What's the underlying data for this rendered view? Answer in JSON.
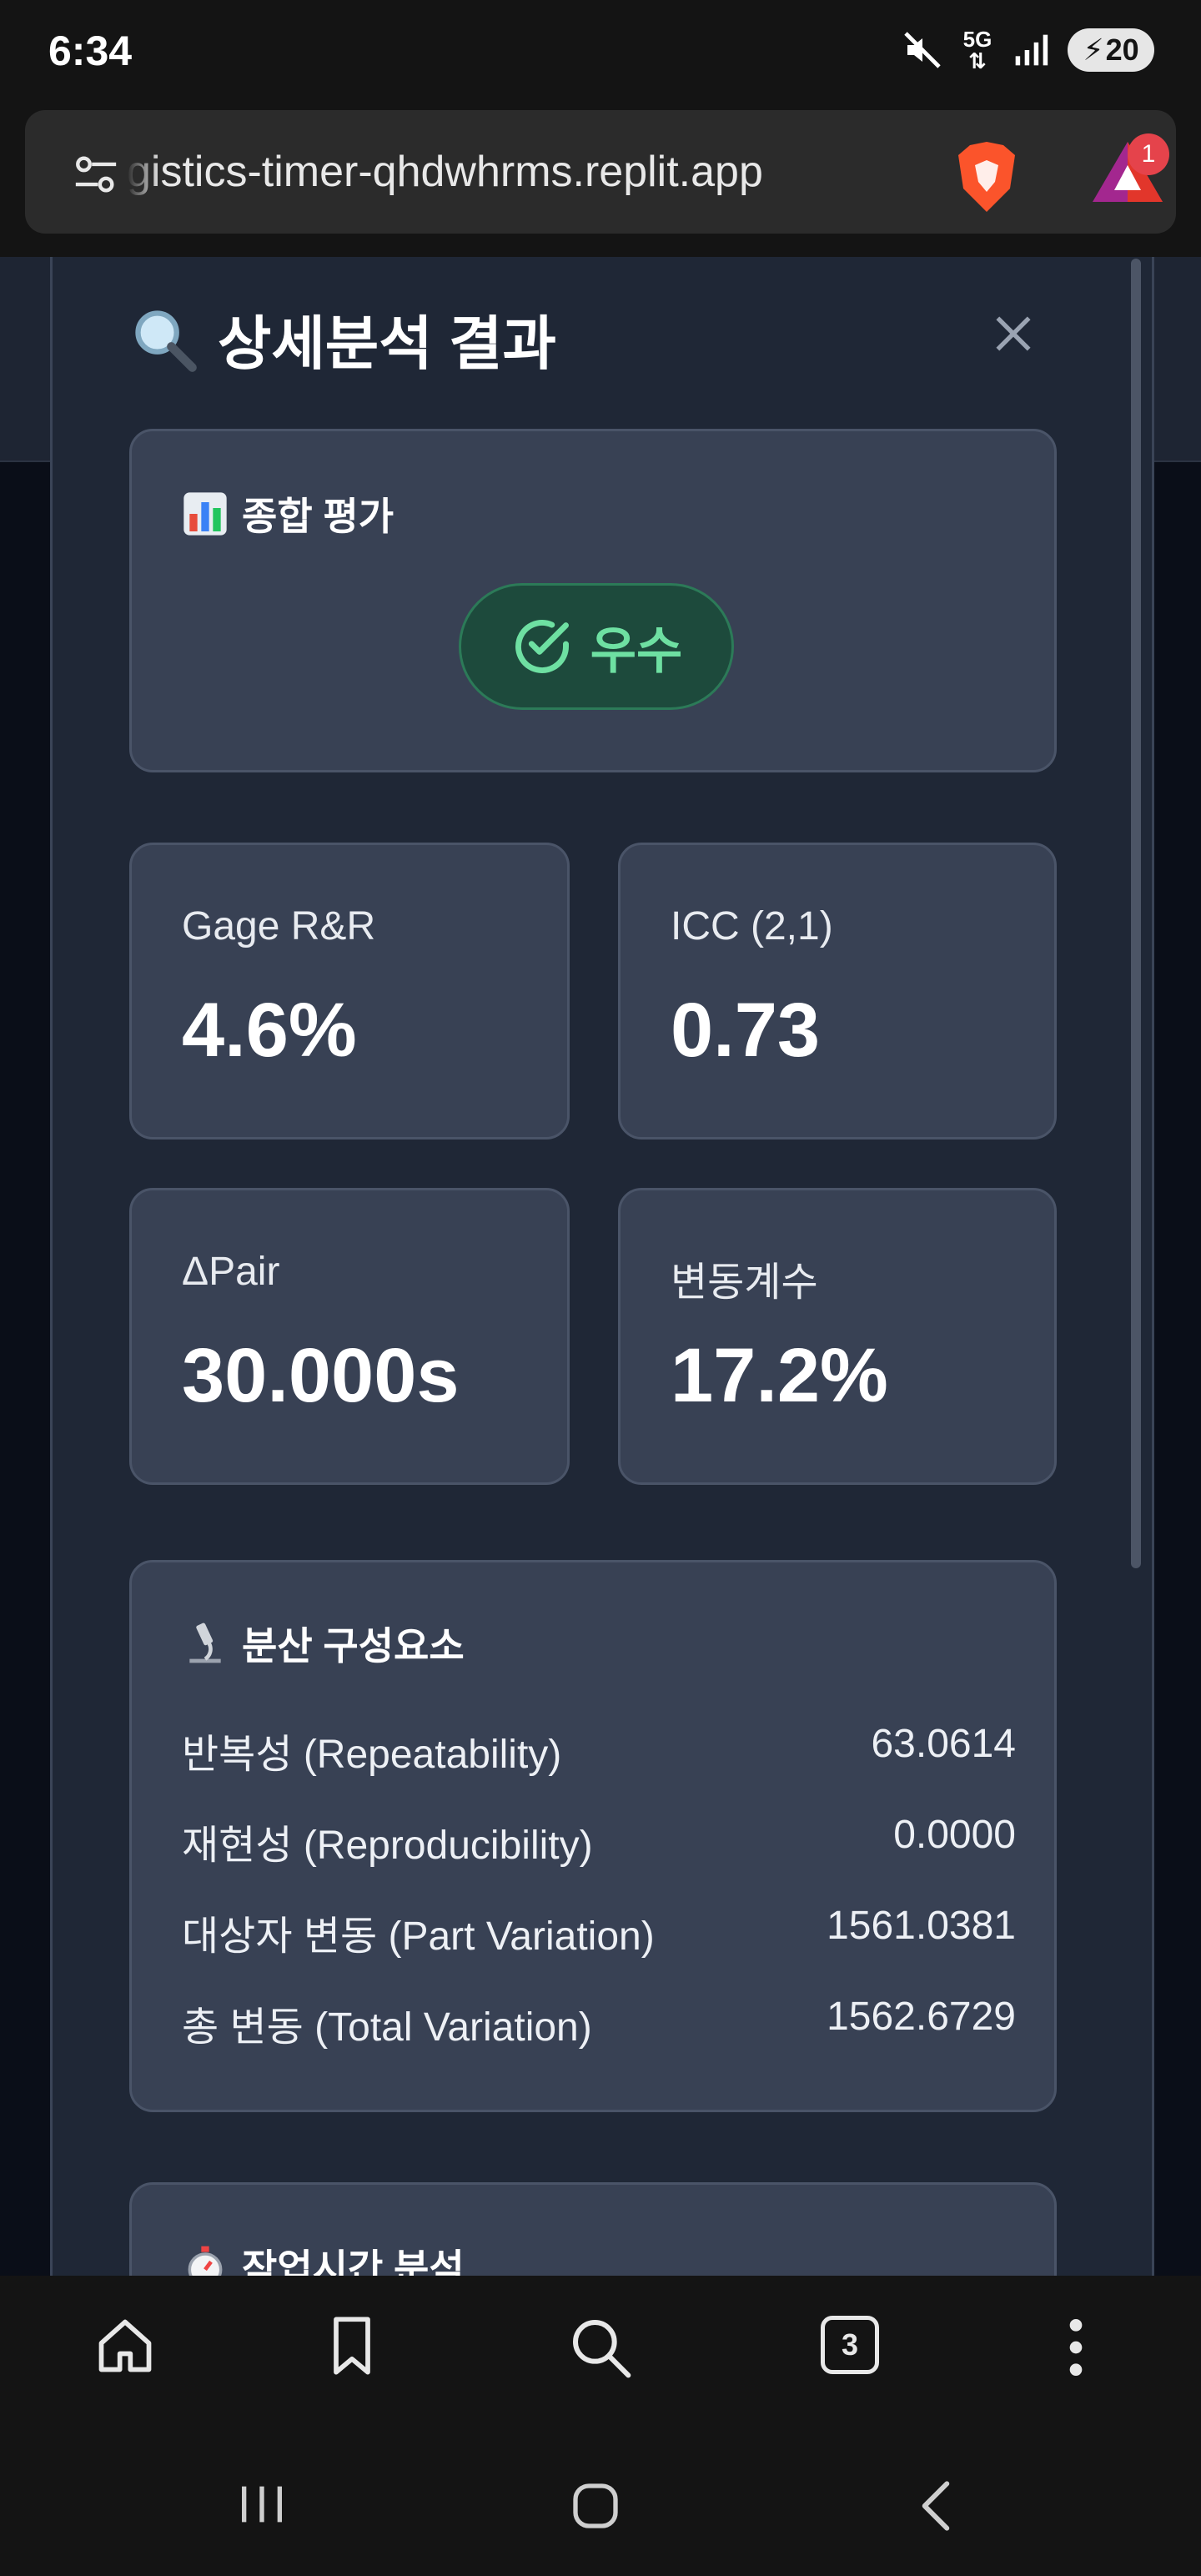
{
  "status_bar": {
    "time": "6:34",
    "battery": "20",
    "network": "5G"
  },
  "browser": {
    "url": "gistics-timer-qhdwhrms.replit.app",
    "rewards_badge": "1",
    "tab_count": "3"
  },
  "modal": {
    "title": "상세분석 결과",
    "title_icon": "magnifier-icon",
    "overall": {
      "heading": "종합 평가",
      "heading_icon": "bar-chart-icon",
      "grade": "우수",
      "grade_color": "#6ee0a2"
    },
    "metrics": [
      {
        "label": "Gage R&R",
        "value": "4.6%"
      },
      {
        "label": "ICC (2,1)",
        "value": "0.73"
      },
      {
        "label": "ΔPair",
        "value": "30.000s"
      },
      {
        "label": "변동계수",
        "value": "17.2%"
      }
    ],
    "variance": {
      "heading": "분산 구성요소",
      "heading_icon": "microscope-icon",
      "rows": [
        {
          "label": "반복성 (Repeatability)",
          "value": "63.0614"
        },
        {
          "label": "재현성 (Reproducibility)",
          "value": "0.0000"
        },
        {
          "label": "대상자 변동 (Part Variation)",
          "value": "1561.0381"
        },
        {
          "label": "총 변동 (Total Variation)",
          "value": "1562.6729"
        }
      ]
    },
    "work_time": {
      "heading": "작업시간 분석",
      "heading_icon": "stopwatch-icon"
    }
  }
}
